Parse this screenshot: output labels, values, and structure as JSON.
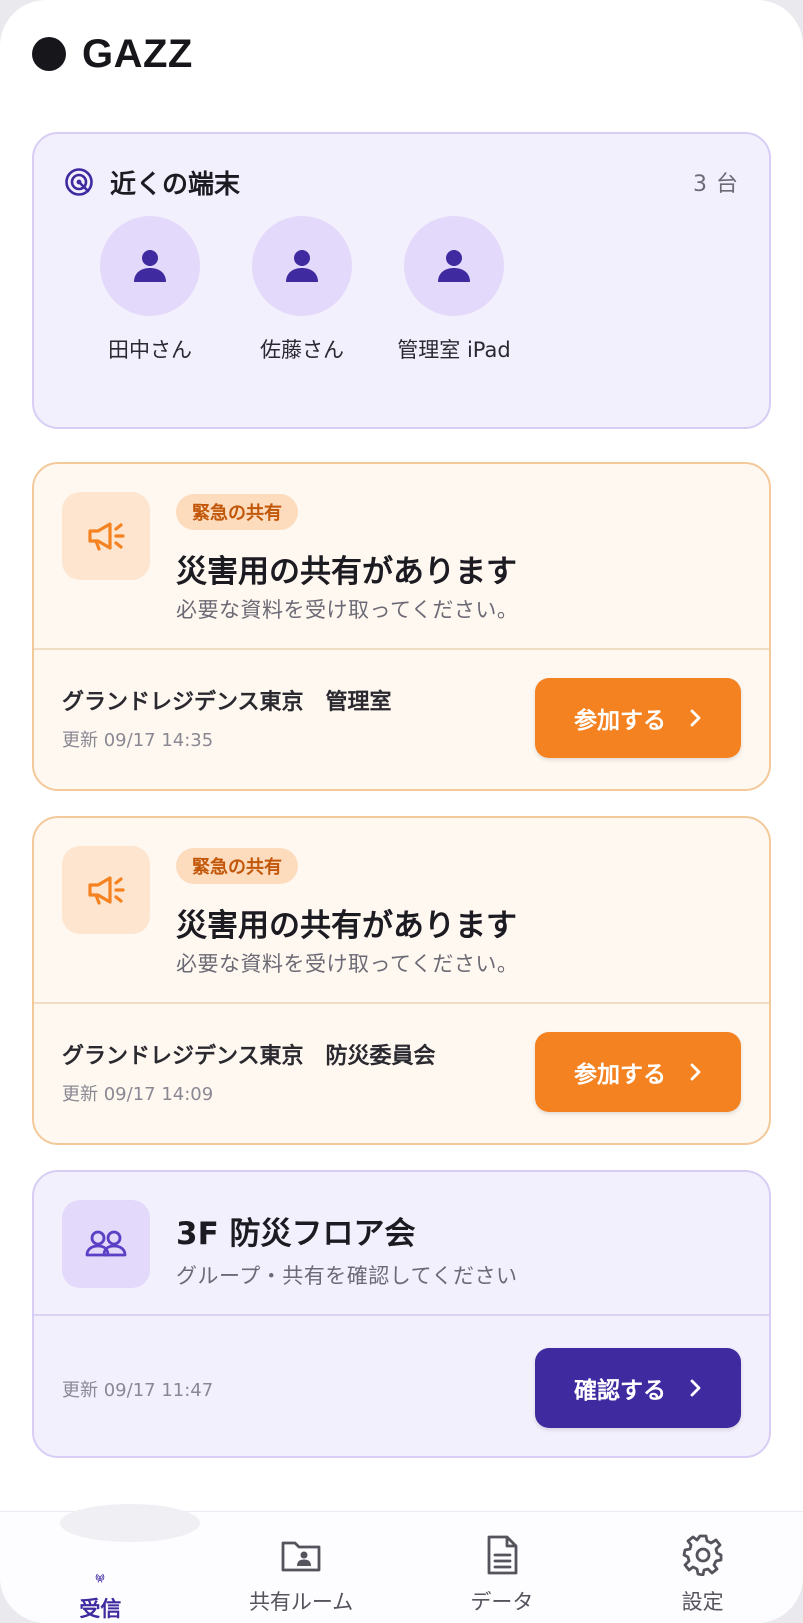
{
  "app": {
    "title": "GAZZ"
  },
  "nearby": {
    "title": "近くの端末",
    "count": "3 台",
    "devices": [
      {
        "name": "田中さん"
      },
      {
        "name": "佐藤さん"
      },
      {
        "name": "管理室 iPad"
      }
    ]
  },
  "alerts": [
    {
      "badge": "緊急の共有",
      "title": "災害用の共有があります",
      "subtitle": "必要な資料を受け取ってください。",
      "room": "グランドレジデンス東京　管理室",
      "updated": "更新 09/17 14:35",
      "button": "参加する"
    },
    {
      "badge": "緊急の共有",
      "title": "災害用の共有があります",
      "subtitle": "必要な資料を受け取ってください。",
      "room": "グランドレジデンス東京　防災委員会",
      "updated": "更新 09/17 14:09",
      "button": "参加する"
    }
  ],
  "group": {
    "title": "3F 防災フロア会",
    "subtitle": "グループ・共有を確認してください",
    "updated": "更新 09/17 11:47",
    "button": "確認する"
  },
  "bottom_nav": [
    {
      "label": "受信",
      "icon": "broadcast-icon",
      "active": true
    },
    {
      "label": "共有ルーム",
      "icon": "shared-folder-icon",
      "active": false
    },
    {
      "label": "データ",
      "icon": "document-icon",
      "active": false
    },
    {
      "label": "設定",
      "icon": "gear-icon",
      "active": false
    }
  ],
  "colors": {
    "accent_purple": "#3f2aa0",
    "accent_orange": "#f58221",
    "badge_text": "#c2570a"
  }
}
